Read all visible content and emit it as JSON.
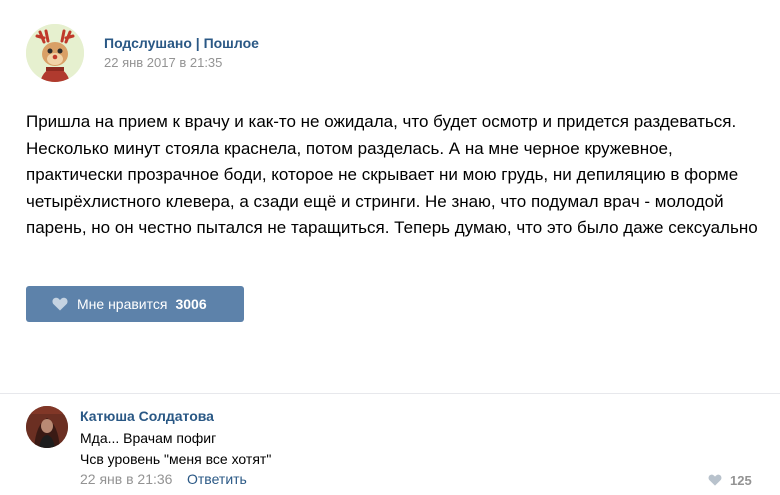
{
  "post": {
    "author": "Подслушано | Пошлое",
    "date": "22 янв 2017 в 21:35",
    "text": "Пришла на прием к врачу и как-то не ожидала, что будет осмотр и придется раздеваться. Несколько минут стояла краснела, потом разделась. А на мне черное кружевное, практически прозрачное боди, которое не скрывает ни мою грудь, ни депиляцию в форме четырёхлистного клевера, а сзади ещё и стринги. Не знаю, что подумал врач - молодой парень, но он честно пытался не таращиться. Теперь думаю, что это было даже сексуально",
    "like_label": "Мне нравится",
    "like_count": "3006",
    "icons": {
      "like": "heart-icon",
      "avatar": "deer-avatar"
    },
    "colors": {
      "like_button": "#5d82aa",
      "link": "#2a5885",
      "meta": "#939393"
    }
  },
  "comment": {
    "author": "Катюша Солдатова",
    "line1": "Мда... Врачам пофиг",
    "line2": "Чсв уровень \"меня все хотят\"",
    "date": "22 янв в 21:36",
    "reply_label": "Ответить",
    "like_count": "125",
    "icons": {
      "like": "heart-icon"
    }
  }
}
